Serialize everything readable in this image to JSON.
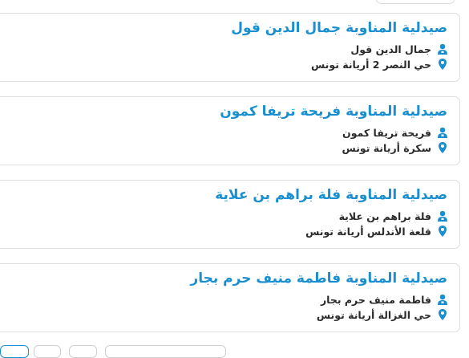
{
  "colors": {
    "accent": "#1a8fd0",
    "text": "#2b2b2b",
    "border": "#dedede"
  },
  "pharmacies": [
    {
      "name": "صيدلية المناوبة جمال الدين قول",
      "owner": "جمال الدين قول",
      "address": "حي النصر 2 أريانة تونس"
    },
    {
      "name": "صيدلية المناوبة فريحة تريفا كمون",
      "owner": "فريحة تريفا كمون",
      "address": "سكرة أريانة تونس"
    },
    {
      "name": "صيدلية المناوبة فلة براهم بن علاية",
      "owner": "فلة براهم بن علاية",
      "address": "قلعة الأندلس أريانة تونس"
    },
    {
      "name": "صيدلية المناوبة فاطمة منيف حرم بجار",
      "owner": "فاطمة منيف حرم بجار",
      "address": "حي الغزالة أريانة تونس"
    }
  ],
  "icons": {
    "owner": "user-icon",
    "address": "map-pin-icon"
  }
}
